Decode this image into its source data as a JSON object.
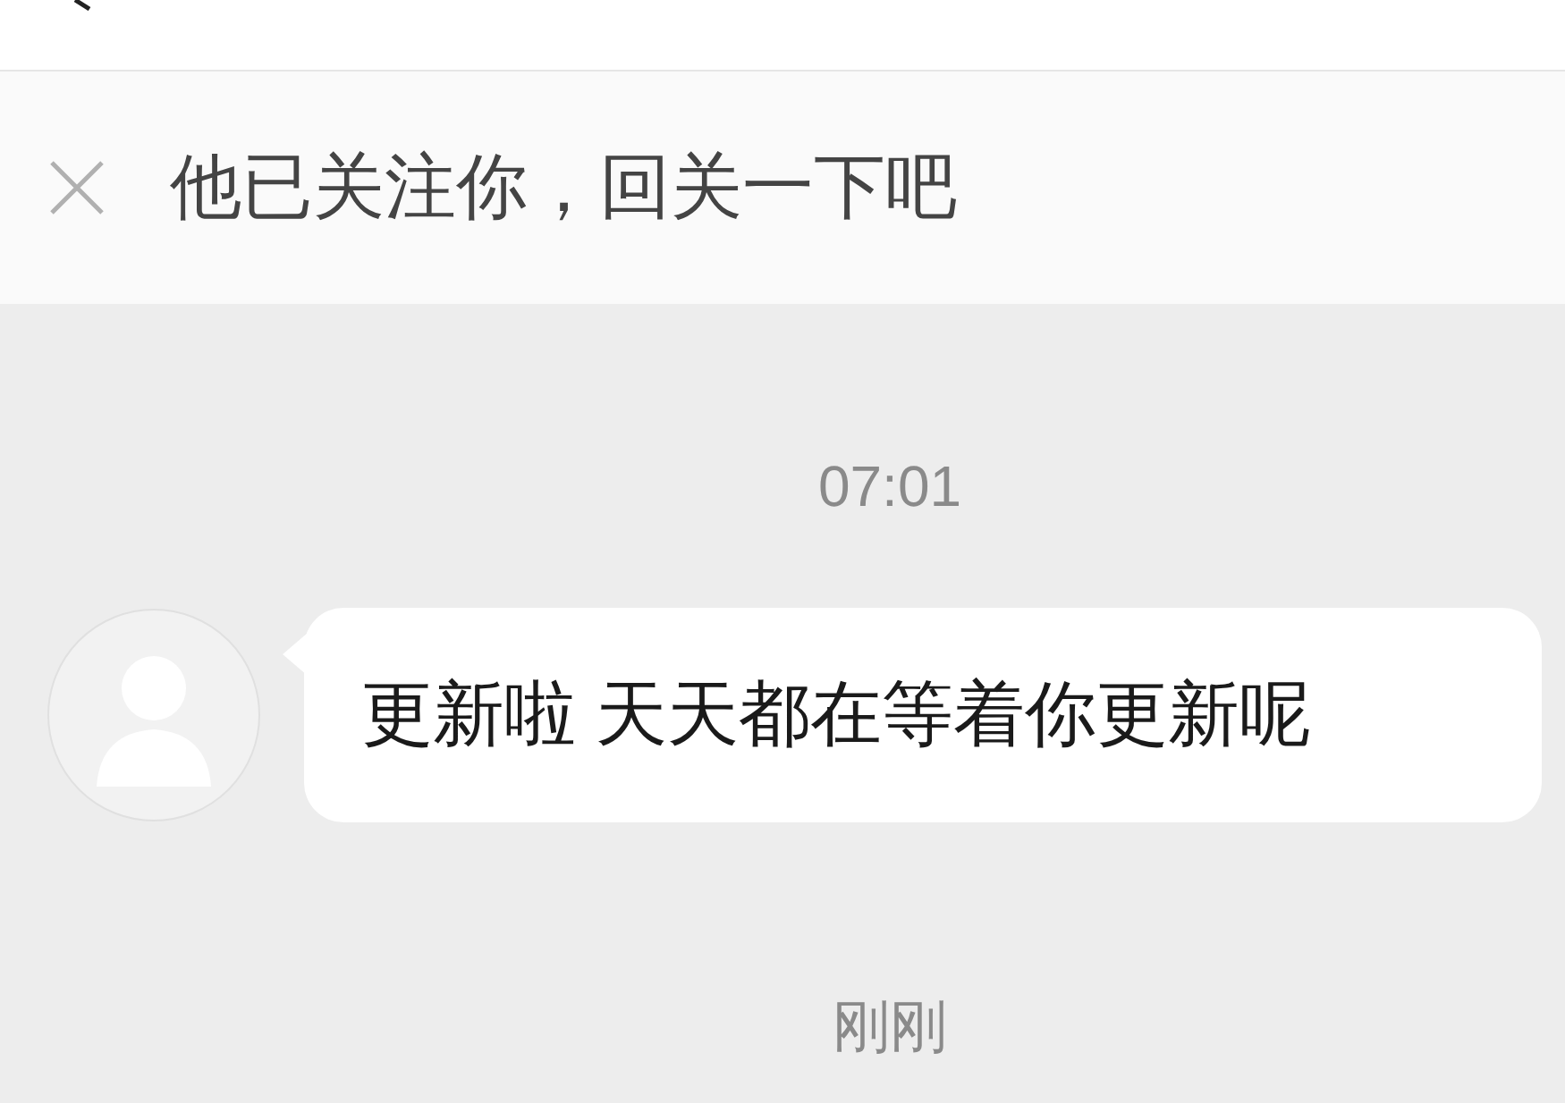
{
  "banner": {
    "text": "他已关注你，回关一下吧"
  },
  "messages": [
    {
      "kind": "time",
      "text": "07:01"
    },
    {
      "kind": "incoming",
      "text": "更新啦 天天都在等着你更新呢"
    },
    {
      "kind": "time",
      "text": "刚刚"
    }
  ]
}
